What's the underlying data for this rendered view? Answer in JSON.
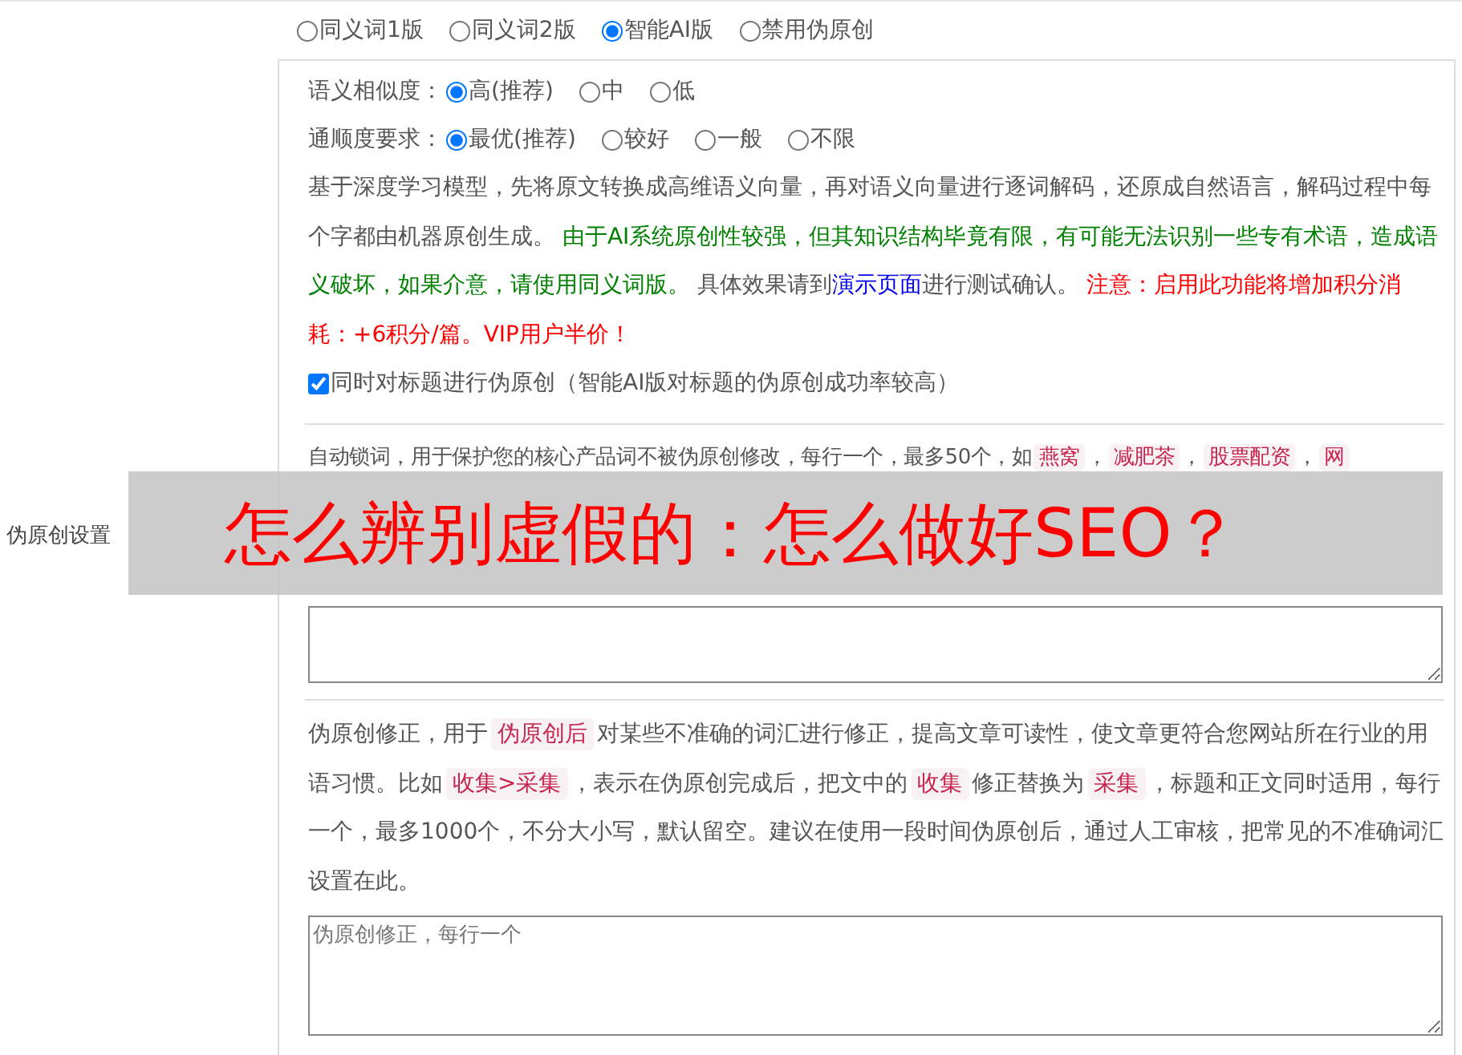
{
  "side_label": "伪原创设置",
  "modes": [
    {
      "label": "同义词1版",
      "selected": false
    },
    {
      "label": "同义词2版",
      "selected": false
    },
    {
      "label": "智能AI版",
      "selected": true
    },
    {
      "label": "禁用伪原创",
      "selected": false
    }
  ],
  "ai_panel": {
    "settings": [
      {
        "label": "语义相似度：",
        "options": [
          {
            "label": "高(推荐)",
            "selected": true
          },
          {
            "label": "中",
            "selected": false
          },
          {
            "label": "低",
            "selected": false
          }
        ]
      },
      {
        "label": "通顺度要求：",
        "options": [
          {
            "label": "最优(推荐)",
            "selected": true
          },
          {
            "label": "较好",
            "selected": false
          },
          {
            "label": "一般",
            "selected": false
          },
          {
            "label": "不限",
            "selected": false
          }
        ]
      }
    ],
    "description": [
      {
        "kind": "plain",
        "text": "基于深度学习模型，先将原文转换成高维语义向量，再对语义向量进行逐词解码，还原成自然语言，解码过程中每个字都由机器原创生成。 "
      },
      {
        "kind": "green",
        "text": "由于AI系统原创性较强，但其知识结构毕竟有限，有可能无法识别一些专有术语，造成语义破坏，如果介意，请使用同义词版。"
      },
      {
        "kind": "plain",
        "text": " 具体效果请到"
      },
      {
        "kind": "link",
        "text": "演示页面"
      },
      {
        "kind": "plain",
        "text": "进行测试确认。 "
      },
      {
        "kind": "red",
        "text": "注意：启用此功能将增加积分消耗：+6积分/篇。VIP用户半价！"
      }
    ],
    "title_option": {
      "label": "同时对标题进行伪原创（智能AI版对标题的伪原创成功率较高）",
      "checked": true
    }
  },
  "lock_words": {
    "description": [
      {
        "kind": "plain",
        "text": "自动锁词，用于保护您的核心产品词不被伪原创修改，每行一个，最多50个，如"
      },
      {
        "kind": "code",
        "text": "燕窝"
      },
      {
        "kind": "plain",
        "text": "，"
      },
      {
        "kind": "code",
        "text": "减肥茶"
      },
      {
        "kind": "plain",
        "text": "，"
      },
      {
        "kind": "code",
        "text": "股票配资"
      },
      {
        "kind": "plain",
        "text": "，"
      },
      {
        "kind": "code",
        "text": "网"
      }
    ]
  },
  "correction": {
    "description": [
      {
        "kind": "plain",
        "text": "伪原创修正，用于"
      },
      {
        "kind": "code",
        "text": "伪原创后"
      },
      {
        "kind": "plain",
        "text": "对某些不准确的词汇进行修正，提高文章可读性，使文章更符合您网站所在行业的用语习惯。比如"
      },
      {
        "kind": "code",
        "text": "收集>采集"
      },
      {
        "kind": "plain",
        "text": "，表示在伪原创完成后，把文中的"
      },
      {
        "kind": "code",
        "text": "收集"
      },
      {
        "kind": "plain",
        "text": "修正替换为"
      },
      {
        "kind": "code",
        "text": "采集"
      },
      {
        "kind": "plain",
        "text": "，标题和正文同时适用，每行一个，最多1000个，不分大小写，默认留空。建议在使用一段时间伪原创后，通过人工审核，把常见的不准确词汇设置在此。"
      }
    ],
    "placeholder": "伪原创修正，每行一个"
  },
  "banner": {
    "text": "怎么辨别虚假的：怎么做好SEO？"
  }
}
